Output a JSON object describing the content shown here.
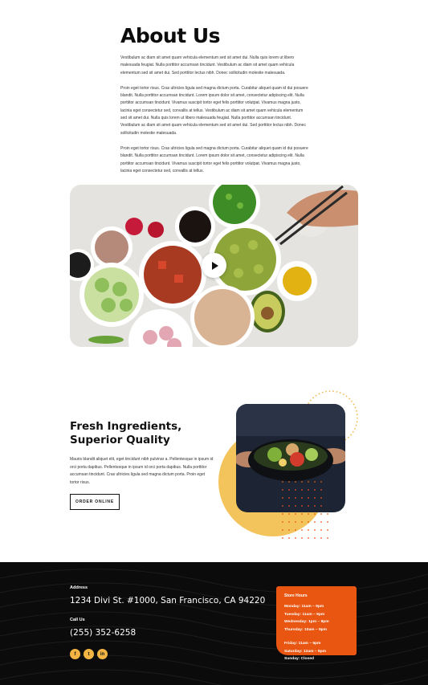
{
  "about": {
    "title": "About Us",
    "paragraphs": [
      "Vestibulum ac diam sit amet quam vehicula elementum sed sit amet dui. Nulla quis lorem ut libero malesuada feugiat. Nulla porttitor accumsan tincidunt. Vestibulum ac diam sit amet quam vehicula elementum sed sit amet dui. Sed porttitor lectus nibh. Donec sollicitudin molestie malesuada.",
      "Proin eget tortor risus. Cras ultricies ligula sed magna dictum porta. Curabitur aliquet quam id dui posuere blandit. Nulla porttitor accumsan tincidunt. Lorem ipsum dolor sit amet, consectetur adipiscing elit. Nulla porttitor accumsan tincidunt. Vivamus suscipit tortor eget felis porttitor volutpat. Vivamus magna justo, lacinia eget consectetur sed, convallis at tellus. Vestibulum ac diam sit amet quam vehicula elementum sed sit amet dui. Nulla quis lorem ut libero malesuada feugiat. Nulla porttitor accumsan tincidunt. Vestibulum ac diam sit amet quam vehicula elementum sed sit amet dui. Sed porttitor lectus nibh. Donec sollicitudin molestie malesuada.",
      "Proin eget tortor risus. Cras ultricies ligula sed magna dictum porta. Curabitur aliquet quam id dui posuere blandit. Nulla porttitor accumsan tincidunt. Lorem ipsum dolor sit amet, consectetur adipiscing elit. Nulla porttitor accumsan tincidunt. Vivamus suscipit tortor eget felis porttitor volutpat. Vivamus magna justo, lacinia eget consectetur sed, convallis at tellus."
    ]
  },
  "video": {
    "icon": "play-icon"
  },
  "feature": {
    "title": "Fresh Ingredients, Superior Quality",
    "text": "Mauris blandit aliquet elit, eget tincidunt nibh pulvinar a. Pellentesque in ipsum id orci porta dapibus. Pellentesque in ipsum id orci porta dapibus. Nulla porttitor accumsan tincidunt. Cras ultricies ligula sed magna dictum porta. Proin eget tortor risus.",
    "button_label": "ORDER ONLINE"
  },
  "footer": {
    "address_label": "Address",
    "address": "1234 Divi St. #1000, San Francisco, CA 94220",
    "phone_label": "Call Us",
    "phone": "(255) 352-6258",
    "social": [
      {
        "icon": "facebook-icon",
        "glyph": "f"
      },
      {
        "icon": "twitter-icon",
        "glyph": "t"
      },
      {
        "icon": "linkedin-icon",
        "glyph": "in"
      }
    ],
    "hours_title": "Store Hours",
    "hours": [
      "Monday: 11am – 9pm",
      "Tuesday: 11am – 9pm",
      "Wednesday: 1pm – 9pm",
      "Thursday: 10am – 9pm",
      "Friday: 11am – 5pm",
      "Saturday: 12am – 9pm",
      "Sunday: Closed"
    ]
  },
  "colors": {
    "accent_orange": "#e85612",
    "accent_yellow": "#f2b544",
    "footer_bg": "#0b0b0b"
  }
}
